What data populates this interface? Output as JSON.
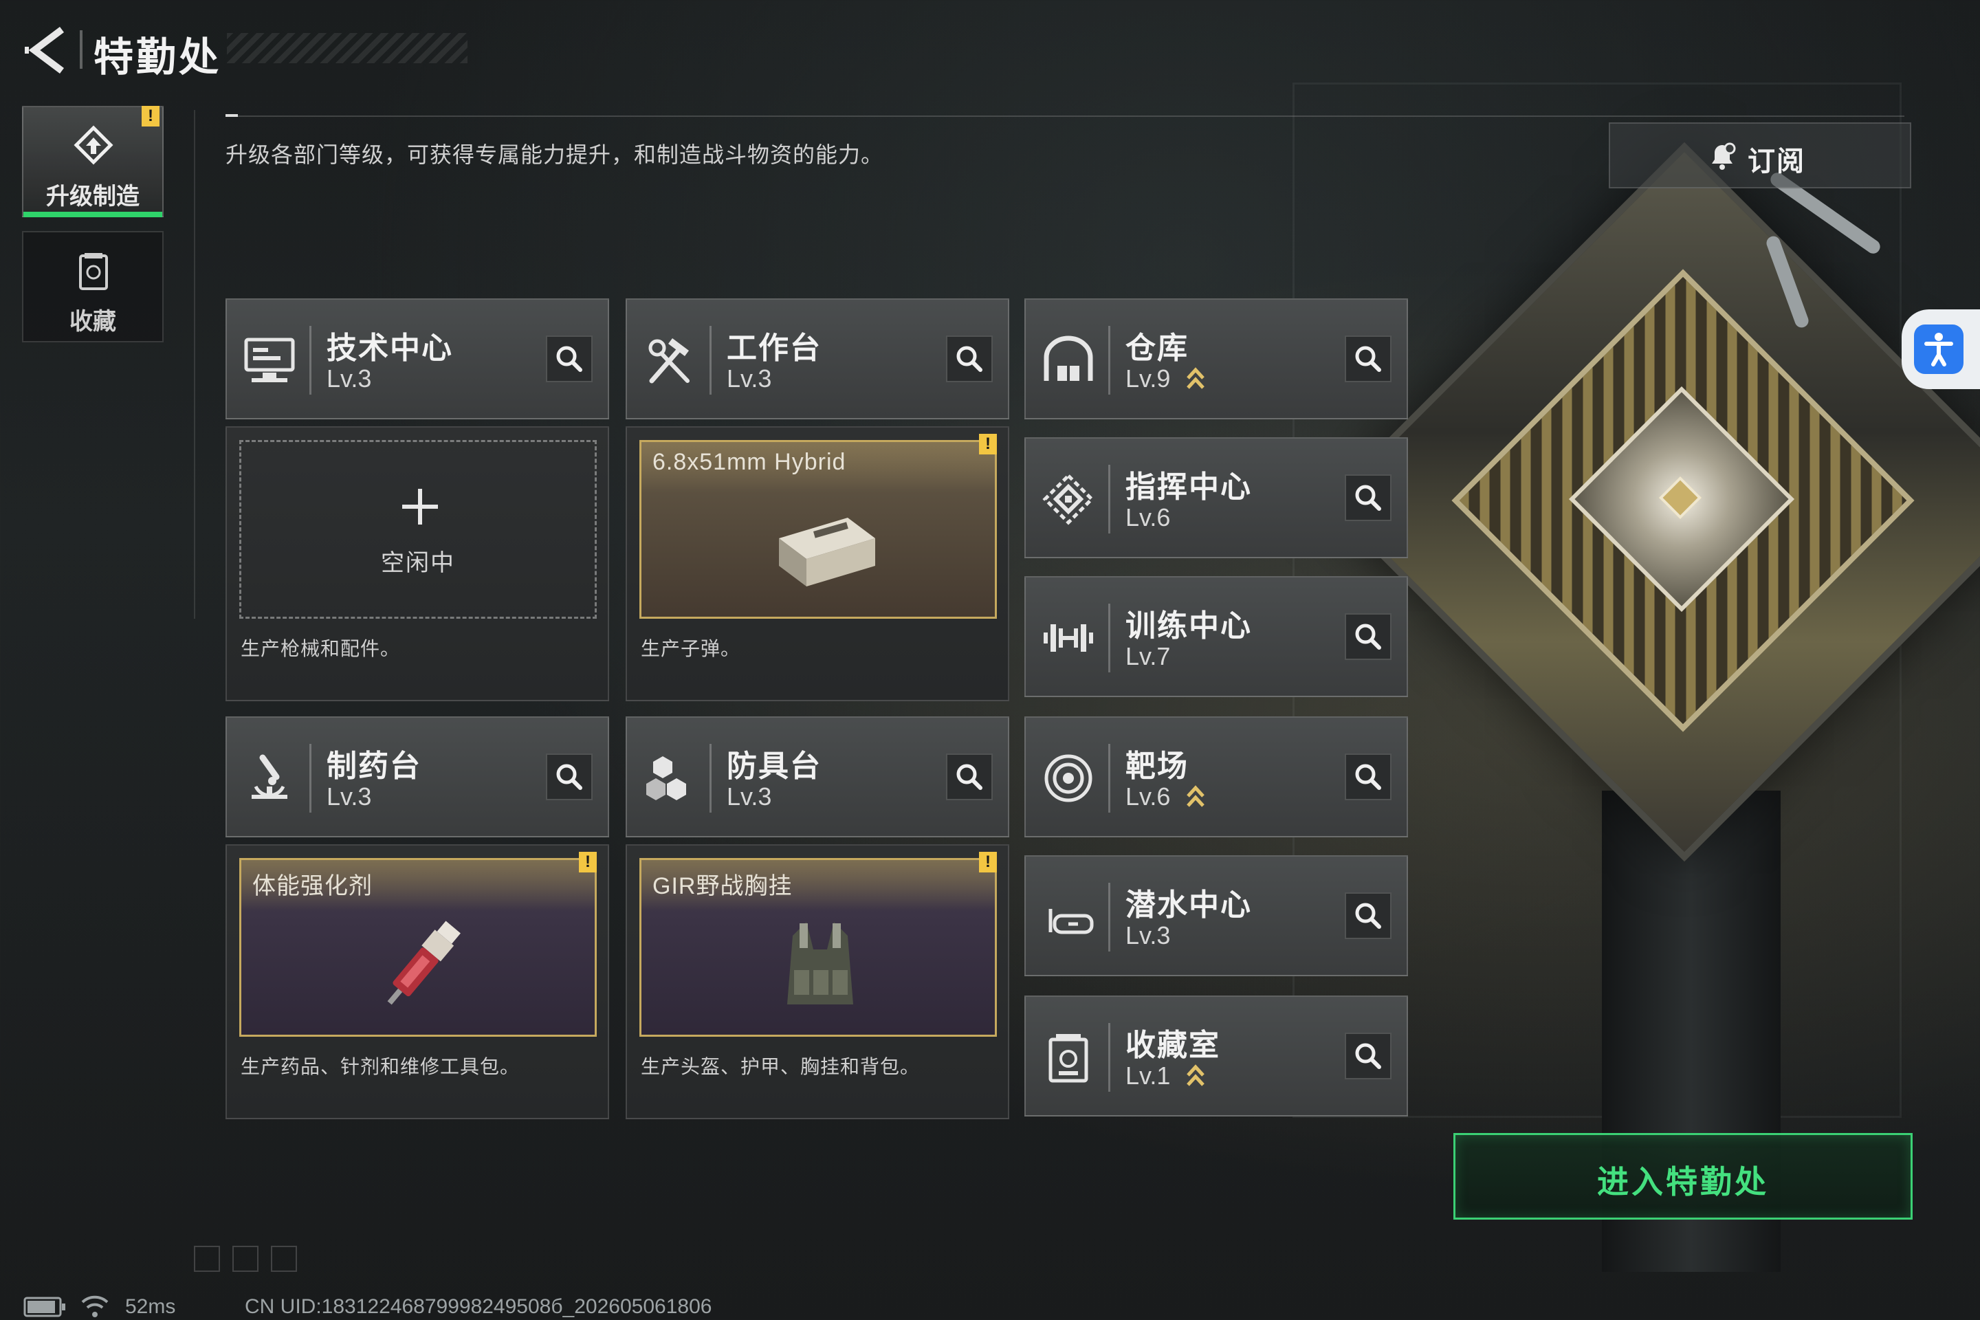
{
  "header": {
    "title": "特勤处",
    "description": "升级各部门等级，可获得专属能力提升，和制造战斗物资的能力。",
    "subscribe_label": "订阅"
  },
  "sidebar": {
    "items": [
      {
        "label": "升级制造",
        "active": true,
        "icon": "upgrade-icon",
        "has_alert": true
      },
      {
        "label": "收藏",
        "active": false,
        "icon": "collection-icon",
        "has_alert": false
      }
    ]
  },
  "alert_mark": "!",
  "facilities": {
    "tech_center": {
      "name": "技术中心",
      "level": "Lv.3",
      "icon": "monitor-icon",
      "description": "生产枪械和配件。",
      "status": "空闲中"
    },
    "workbench": {
      "name": "工作台",
      "level": "Lv.3",
      "icon": "hammer-wrench-icon",
      "description": "生产子弹。",
      "item": "6.8x51mm Hybrid"
    },
    "pharmacy": {
      "name": "制药台",
      "level": "Lv.3",
      "icon": "microscope-icon",
      "description": "生产药品、针剂和维修工具包。",
      "item": "体能强化剂"
    },
    "armor_bench": {
      "name": "防具台",
      "level": "Lv.3",
      "icon": "cubes-icon",
      "description": "生产头盔、护甲、胸挂和背包。",
      "item": "GIR野战胸挂"
    },
    "warehouse": {
      "name": "仓库",
      "level": "Lv.9",
      "icon": "warehouse-icon",
      "upgradable": true
    },
    "command_center": {
      "name": "指挥中心",
      "level": "Lv.6",
      "icon": "command-icon",
      "upgradable": false
    },
    "training_center": {
      "name": "训练中心",
      "level": "Lv.7",
      "icon": "dumbbell-icon",
      "upgradable": false
    },
    "shooting_range": {
      "name": "靶场",
      "level": "Lv.6",
      "icon": "target-icon",
      "upgradable": true
    },
    "diving_center": {
      "name": "潜水中心",
      "level": "Lv.3",
      "icon": "diving-mask-icon",
      "upgradable": false
    },
    "collection_room": {
      "name": "收藏室",
      "level": "Lv.1",
      "icon": "collection-room-icon",
      "upgradable": true
    }
  },
  "enter_button": "进入特勤处",
  "footer": {
    "ping": "52ms",
    "uid": "CN UID:18312246879998249508б_202605061806"
  },
  "colors": {
    "accent_green": "#3bd074",
    "warning_yellow": "#f3c642",
    "upgrade_gold": "#e2c26a",
    "slot_border_gold": "#c6a95e"
  }
}
